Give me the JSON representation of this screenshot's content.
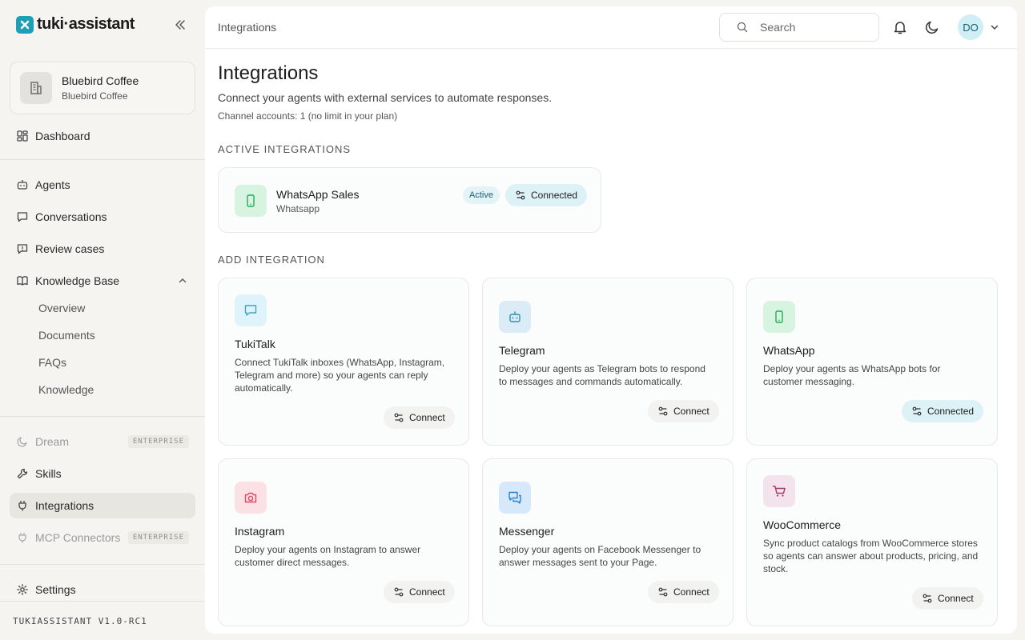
{
  "app": {
    "logo_text": "tuki·assistant",
    "version": "TUKIASSISTANT V1.0-RC1"
  },
  "org": {
    "name": "Bluebird Coffee",
    "sub": "Bluebird Coffee"
  },
  "sidebar": {
    "dashboard": "Dashboard",
    "agents": "Agents",
    "conversations": "Conversations",
    "review_cases": "Review cases",
    "knowledge_base": "Knowledge Base",
    "kb_items": [
      "Overview",
      "Documents",
      "FAQs",
      "Knowledge"
    ],
    "dream": "Dream",
    "skills": "Skills",
    "integrations": "Integrations",
    "mcp": "MCP Connectors",
    "enterprise_badge": "ENTERPRISE",
    "settings": "Settings"
  },
  "topbar": {
    "breadcrumb": "Integrations",
    "search_placeholder": "Search",
    "avatar_initials": "DO"
  },
  "page": {
    "title": "Integrations",
    "subtitle": "Connect your agents with external services to automate responses.",
    "note": "Channel accounts: 1 (no limit in your plan)",
    "active_label": "ACTIVE INTEGRATIONS",
    "add_label": "ADD INTEGRATION"
  },
  "active": {
    "name": "WhatsApp Sales",
    "type": "Whatsapp",
    "status": "Active",
    "button": "Connected"
  },
  "cards": [
    {
      "title": "TukiTalk",
      "desc": "Connect TukiTalk inboxes (WhatsApp, Instagram, Telegram and more) so your agents can reply automatically.",
      "button": "Connect",
      "icon": "chat-icon",
      "color": "#dff4fa"
    },
    {
      "title": "Telegram",
      "desc": "Deploy your agents as Telegram bots to respond to messages and commands automatically.",
      "button": "Connect",
      "icon": "bot-icon",
      "color": "#dcecf7"
    },
    {
      "title": "WhatsApp",
      "desc": "Deploy your agents as WhatsApp bots for customer messaging.",
      "button": "Connected",
      "icon": "phone-icon",
      "color": "#d7f4e0"
    },
    {
      "title": "Instagram",
      "desc": "Deploy your agents on Instagram to answer customer direct messages.",
      "button": "Connect",
      "icon": "camera-icon",
      "color": "#fbe0e4"
    },
    {
      "title": "Messenger",
      "desc": "Deploy your agents on Facebook Messenger to answer messages sent to your Page.",
      "button": "Connect",
      "icon": "messages-icon",
      "color": "#d6e9fb"
    },
    {
      "title": "WooCommerce",
      "desc": "Sync product catalogs from WooCommerce stores so agents can answer about products, pricing, and stock.",
      "button": "Connect",
      "icon": "cart-icon",
      "color": "#f3e3ec"
    }
  ]
}
